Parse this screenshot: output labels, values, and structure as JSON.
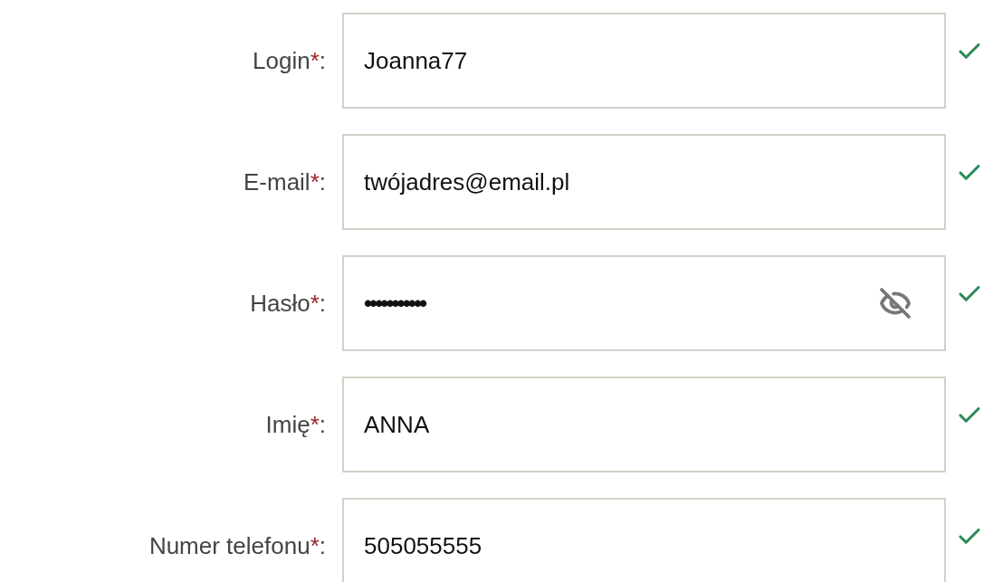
{
  "fields": [
    {
      "label": "Login",
      "required_mark": "*",
      "suffix": ":",
      "kind": "text",
      "value": "Joanna77",
      "valid": true
    },
    {
      "label": "E-mail",
      "required_mark": "*",
      "suffix": ":",
      "kind": "text",
      "value": "twójadres@email.pl",
      "valid": true
    },
    {
      "label": "Hasło",
      "required_mark": "*",
      "suffix": ":",
      "kind": "password",
      "value": "•••••••••••",
      "valid": true
    },
    {
      "label": "Imię",
      "required_mark": "*",
      "suffix": ":",
      "kind": "text",
      "value": "ANNA",
      "valid": true
    },
    {
      "label": "Numer telefonu",
      "required_mark": "*",
      "suffix": ":",
      "kind": "text",
      "value": "505055555",
      "valid": true
    }
  ]
}
